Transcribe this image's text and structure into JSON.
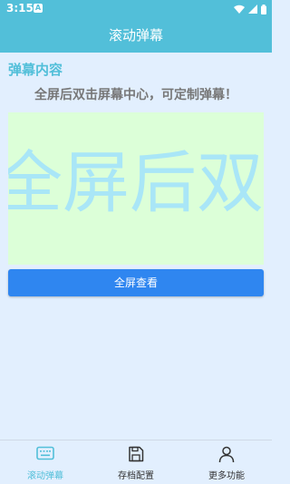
{
  "status_bar": {
    "time": "3:15",
    "notification_badge": "A"
  },
  "app_bar": {
    "title": "滚动弹幕"
  },
  "content": {
    "section_title": "弹幕内容",
    "hint": "全屏后双击屏幕中心，可定制弹幕！",
    "preview_text": "全屏后双击屏幕中心，可定制弹幕！",
    "fullscreen_button": "全屏查看"
  },
  "bottom_nav": {
    "items": [
      {
        "label": "滚动弹幕",
        "icon": "keyboard-icon",
        "active": true
      },
      {
        "label": "存档配置",
        "icon": "save-icon",
        "active": false
      },
      {
        "label": "更多功能",
        "icon": "person-icon",
        "active": false
      }
    ]
  },
  "colors": {
    "accent": "#52bfd9",
    "background": "#e2effe",
    "preview_bg": "#dcffd8",
    "preview_text": "#a9e6f7",
    "button": "#2f86f0"
  }
}
